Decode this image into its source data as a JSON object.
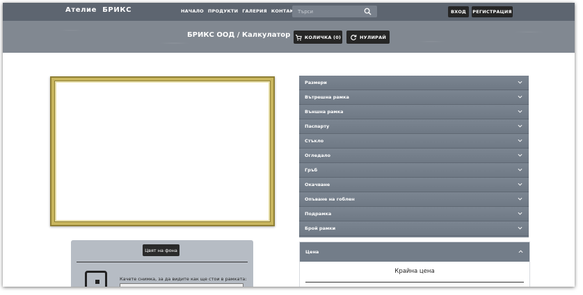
{
  "header": {
    "brand": "Ателие  БРИКС",
    "nav": [
      "НАЧАЛО",
      "ПРОДУКТИ",
      "ГАЛЕРИЯ",
      "КОНТАКТИ"
    ],
    "search_placeholder": "Търси",
    "login": "ВХОД",
    "register": "РЕГИСТРАЦИЯ"
  },
  "banner": {
    "title": "БРИКС ООД / Калкулатор",
    "cart": "КОЛИЧКА (0)",
    "reset": "НУЛИРАЙ"
  },
  "preview": {
    "bg_color_button": "Цвят на фона",
    "upload_text": "Качете снимка, за да видите как ще стои в рамката:"
  },
  "options": {
    "items": [
      "Размери",
      "Вътрешна рамка",
      "Външна рамка",
      "Паспарту",
      "Стъкло",
      "Огледало",
      "Гръб",
      "Окачване",
      "Опъване на гоблен",
      "Подрамка",
      "Брой рамки"
    ]
  },
  "price": {
    "header": "Цена",
    "title": "Крайна цена"
  },
  "colors": {
    "topbar": "#5d6570",
    "banner": "#818891",
    "accordion": "#76808c",
    "frame_gold": "#c9b65e"
  }
}
